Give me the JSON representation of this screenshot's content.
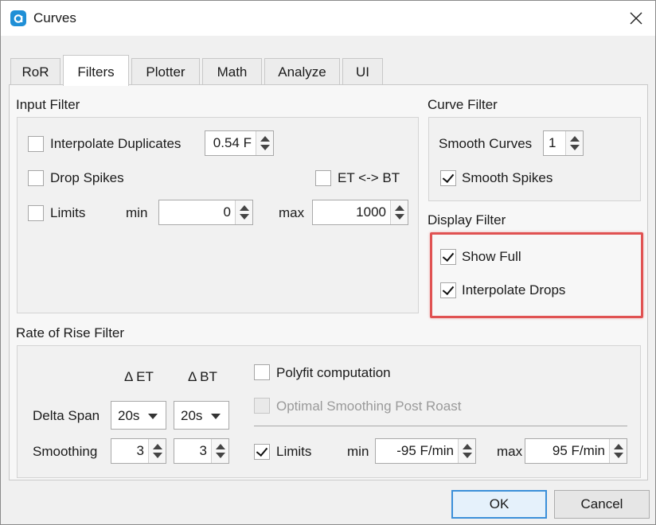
{
  "window": {
    "title": "Curves"
  },
  "tabs": [
    "RoR",
    "Filters",
    "Plotter",
    "Math",
    "Analyze",
    "UI"
  ],
  "active_tab": "Filters",
  "input_filter": {
    "label": "Input Filter",
    "interpolate_duplicates": {
      "label": "Interpolate Duplicates",
      "checked": false,
      "value": "0.54 F"
    },
    "drop_spikes": {
      "label": "Drop Spikes",
      "checked": false
    },
    "et_bt": {
      "label": "ET <-> BT",
      "checked": false
    },
    "limits": {
      "label": "Limits",
      "checked": false,
      "min_label": "min",
      "min_value": "0",
      "max_label": "max",
      "max_value": "1000"
    }
  },
  "curve_filter": {
    "label": "Curve Filter",
    "smooth_curves": {
      "label": "Smooth Curves",
      "value": "1"
    },
    "smooth_spikes": {
      "label": "Smooth Spikes",
      "checked": true
    }
  },
  "display_filter": {
    "label": "Display Filter",
    "show_full": {
      "label": "Show Full",
      "checked": true
    },
    "interpolate_drops": {
      "label": "Interpolate Drops",
      "checked": true
    }
  },
  "ror_filter": {
    "label": "Rate of Rise Filter",
    "delta_et_header": "Δ ET",
    "delta_bt_header": "Δ BT",
    "delta_span": {
      "label": "Delta Span",
      "et": "20s",
      "bt": "20s"
    },
    "smoothing": {
      "label": "Smoothing",
      "et": "3",
      "bt": "3"
    },
    "polyfit": {
      "label": "Polyfit computation",
      "checked": false
    },
    "optimal_smoothing": {
      "label": "Optimal Smoothing Post Roast",
      "checked": false,
      "disabled": true
    },
    "limits": {
      "label": "Limits",
      "checked": true,
      "min_label": "min",
      "min_value": "-95 F/min",
      "max_label": "max",
      "max_value": "95 F/min"
    }
  },
  "buttons": {
    "ok": "OK",
    "cancel": "Cancel"
  },
  "colors": {
    "highlight": "#e05252",
    "accent": "#3b8fd9",
    "app_icon": "#1f8fd6"
  }
}
